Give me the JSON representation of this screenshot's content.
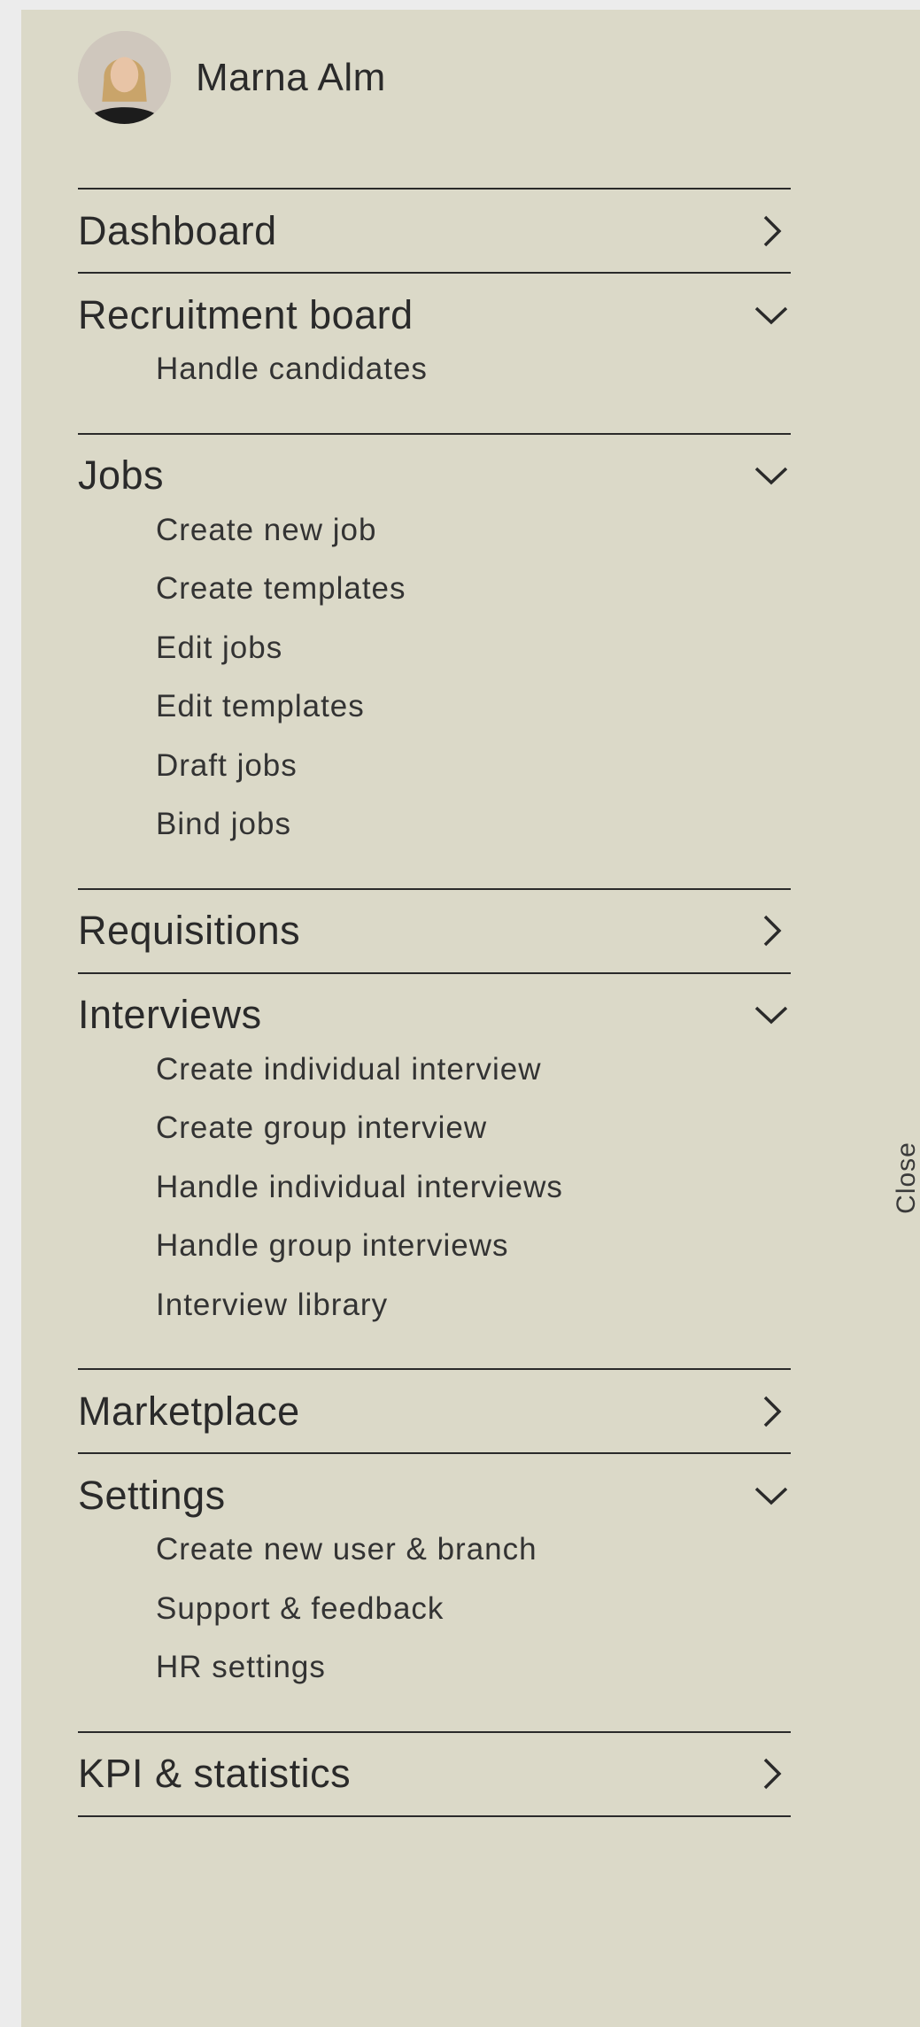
{
  "user": {
    "name": "Marna Alm"
  },
  "nav": {
    "dashboard": {
      "label": "Dashboard",
      "icon": "chevron-right-icon"
    },
    "recruitment_board": {
      "label": "Recruitment board",
      "icon": "chevron-down-icon",
      "items": [
        "Handle candidates"
      ]
    },
    "jobs": {
      "label": "Jobs",
      "icon": "chevron-down-icon",
      "items": [
        "Create new job",
        "Create templates",
        "Edit jobs",
        "Edit templates",
        "Draft jobs",
        "Bind jobs"
      ]
    },
    "requisitions": {
      "label": "Requisitions",
      "icon": "chevron-right-icon"
    },
    "interviews": {
      "label": "Interviews",
      "icon": "chevron-down-icon",
      "items": [
        "Create individual interview",
        "Create group interview",
        "Handle individual interviews",
        "Handle group interviews",
        "Interview library"
      ]
    },
    "marketplace": {
      "label": "Marketplace",
      "icon": "chevron-right-icon"
    },
    "settings": {
      "label": "Settings",
      "icon": "chevron-down-icon",
      "items": [
        "Create new user & branch",
        "Support & feedback",
        "HR settings"
      ]
    },
    "kpi_statistics": {
      "label": "KPI & statistics",
      "icon": "chevron-right-icon"
    }
  },
  "close_label": "Close",
  "colors": {
    "panel_bg": "#dbd9c8",
    "page_bg": "#ececec",
    "text": "#2a2a2a"
  }
}
